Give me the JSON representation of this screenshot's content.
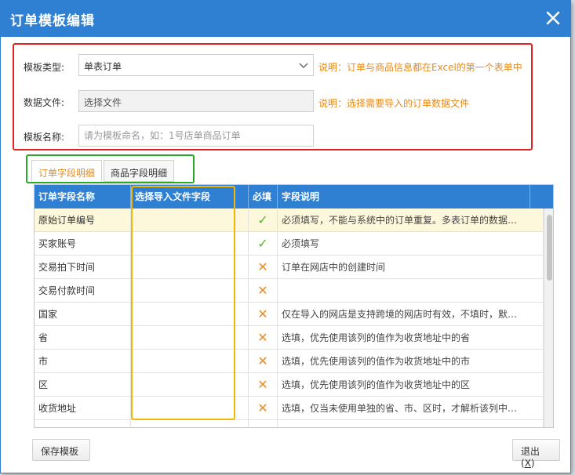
{
  "dialog": {
    "title": "订单模板编辑",
    "close_icon": "close-icon"
  },
  "form": {
    "template_type_label": "模板类型:",
    "template_type_value": "单表订单",
    "template_type_note": "说明：订单与商品信息都在Excel的第一个表单中",
    "data_file_label": "数据文件:",
    "data_file_value": "选择文件",
    "data_file_note": "说明：选择需要导入的订单数据文件",
    "template_name_label": "模板名称:",
    "template_name_placeholder": "请为模板命名，如：1号店单商品订单"
  },
  "tabs": [
    {
      "label": "订单字段明细",
      "active": true
    },
    {
      "label": "商品字段明细",
      "active": false
    }
  ],
  "grid": {
    "columns": [
      "订单字段名称",
      "选择导入文件字段",
      "必填",
      "字段说明"
    ],
    "rows": [
      {
        "name": "原始订单编号",
        "field": "",
        "required": "✓",
        "desc": "必须填写，不能与系统中的订单重复。多表订单的数据…",
        "selected": true
      },
      {
        "name": "买家账号",
        "field": "",
        "required": "✓",
        "desc": "必须填写"
      },
      {
        "name": "交易拍下时间",
        "field": "",
        "required": "✕",
        "desc": "订单在网店中的创建时间"
      },
      {
        "name": "交易付款时间",
        "field": "",
        "required": "✕",
        "desc": ""
      },
      {
        "name": "国家",
        "field": "",
        "required": "✕",
        "desc": "仅在导入的网店是支持跨境的网店时有效，不填时，默…"
      },
      {
        "name": "省",
        "field": "",
        "required": "✕",
        "desc": "选填，优先使用该列的值作为收货地址中的省"
      },
      {
        "name": "市",
        "field": "",
        "required": "✕",
        "desc": "选填，优先使用该列的值作为收货地址中的市"
      },
      {
        "name": "区",
        "field": "",
        "required": "✕",
        "desc": "选填，优先使用该列的值作为收货地址中的区"
      },
      {
        "name": "收货地址",
        "field": "",
        "required": "✕",
        "desc": "选填，仅当未使用单独的省、市、区时，才解析该列中…"
      },
      {
        "name": "",
        "field": "",
        "required": "",
        "desc": ""
      }
    ]
  },
  "footer": {
    "save_label": "保存模板",
    "exit_label": "退出(",
    "exit_hotkey": "X",
    "exit_suffix": ")"
  },
  "colors": {
    "accent": "#2f7fd2",
    "note": "#e58a1e",
    "check": "#5ab52a",
    "cross": "#f08a1e"
  }
}
